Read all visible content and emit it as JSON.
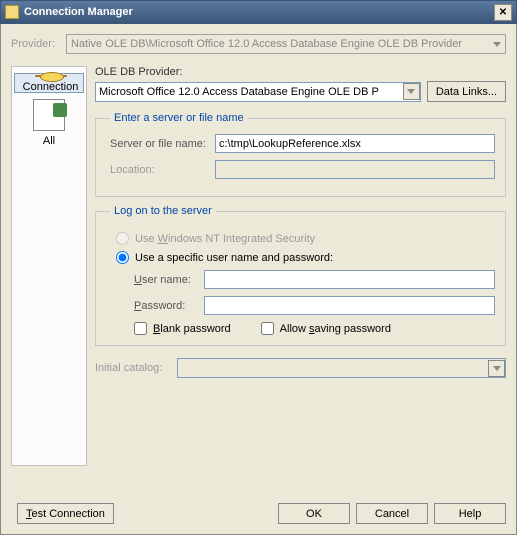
{
  "title": "Connection Manager",
  "provider_label": "Provider:",
  "provider_value": "Native OLE DB\\Microsoft Office 12.0 Access Database Engine OLE DB Provider",
  "sidebar": {
    "connection": "Connection",
    "all": "All"
  },
  "ole": {
    "header": "OLE DB Provider:",
    "value": "Microsoft Office 12.0 Access Database Engine OLE DB P",
    "data_links": "Data Links..."
  },
  "server_group": {
    "legend": "Enter a server or file name",
    "server_label": "Server or file name:",
    "server_value": "c:\\tmp\\LookupReference.xlsx",
    "location_label": "Location:",
    "location_value": ""
  },
  "logon": {
    "legend": "Log on to the server",
    "integrated": "Use Windows NT Integrated Security",
    "specific": "Use a specific user name and password:",
    "username_label": "User name:",
    "username_value": "",
    "password_label": "Password:",
    "password_value": "",
    "blank_pw": "Blank password",
    "allow_save": "Allow saving password"
  },
  "catalog": {
    "label": "Initial catalog:",
    "value": ""
  },
  "buttons": {
    "test": "Test Connection",
    "ok": "OK",
    "cancel": "Cancel",
    "help": "Help"
  }
}
